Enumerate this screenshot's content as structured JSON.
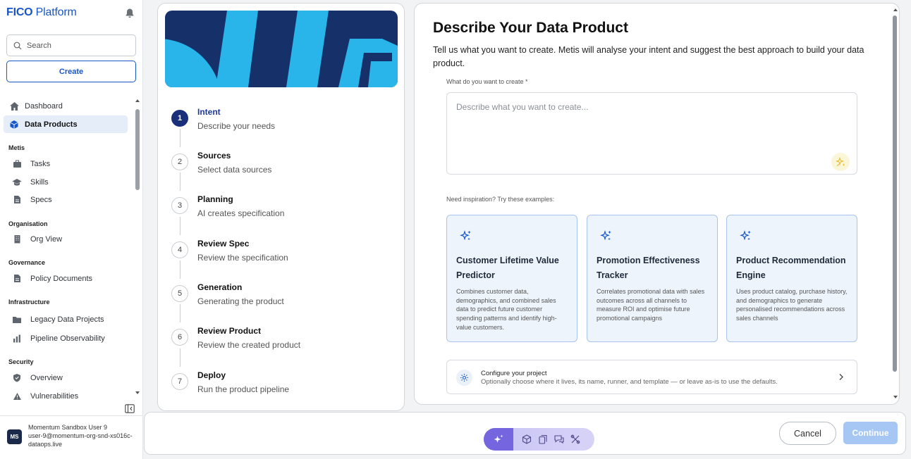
{
  "app": {
    "brand_bold": "FICO",
    "brand_rest": " Platform"
  },
  "sidebar": {
    "search_placeholder": "Search",
    "create_label": "Create",
    "items": [
      {
        "label": "Dashboard",
        "icon": "home-icon"
      },
      {
        "label": "Data Products",
        "icon": "cube-icon",
        "active": true
      }
    ],
    "sections": [
      {
        "label": "Metis",
        "items": [
          {
            "label": "Tasks",
            "icon": "briefcase-icon"
          },
          {
            "label": "Skills",
            "icon": "graduation-cap-icon"
          },
          {
            "label": "Specs",
            "icon": "document-icon"
          }
        ]
      },
      {
        "label": "Organisation",
        "items": [
          {
            "label": "Org View",
            "icon": "building-icon"
          }
        ]
      },
      {
        "label": "Governance",
        "items": [
          {
            "label": "Policy Documents",
            "icon": "document-icon"
          }
        ]
      },
      {
        "label": "Infrastructure",
        "items": [
          {
            "label": "Legacy Data Projects",
            "icon": "folder-icon"
          },
          {
            "label": "Pipeline Observability",
            "icon": "bar-chart-icon"
          }
        ]
      },
      {
        "label": "Security",
        "items": [
          {
            "label": "Overview",
            "icon": "shield-icon"
          },
          {
            "label": "Vulnerabilities",
            "icon": "warning-icon"
          }
        ]
      }
    ],
    "user": {
      "initials": "MS",
      "name": "Momentum Sandbox User 9",
      "email": "user-9@momentum-org-snd-xs016c-dataops.live"
    }
  },
  "stepper": {
    "steps": [
      {
        "num": "1",
        "title": "Intent",
        "desc": "Describe your needs",
        "active": true
      },
      {
        "num": "2",
        "title": "Sources",
        "desc": "Select data sources"
      },
      {
        "num": "3",
        "title": "Planning",
        "desc": "AI creates specification"
      },
      {
        "num": "4",
        "title": "Review Spec",
        "desc": "Review the specification"
      },
      {
        "num": "5",
        "title": "Generation",
        "desc": "Generating the product"
      },
      {
        "num": "6",
        "title": "Review Product",
        "desc": "Review the created product"
      },
      {
        "num": "7",
        "title": "Deploy",
        "desc": "Run the product pipeline"
      }
    ]
  },
  "main": {
    "title": "Describe Your Data Product",
    "intro": "Tell us what you want to create. Metis will analyse your intent and suggest the best approach to build your data product.",
    "field_label": "What do you want to create *",
    "field_placeholder": "Describe what you want to create...",
    "field_value": "",
    "inspiration_label": "Need inspiration? Try these examples:",
    "examples": [
      {
        "title": "Customer Lifetime Value Predictor",
        "desc": "Combines customer data, demographics, and combined sales data to predict future customer spending patterns and identify high-value customers."
      },
      {
        "title": "Promotion Effectiveness Tracker",
        "desc": "Correlates promotional data with sales outcomes across all channels to measure ROI and optimise future promotional campaigns"
      },
      {
        "title": "Product Recommendation Engine",
        "desc": "Uses product catalog, purchase history, and demographics to generate personalised recommendations across sales channels"
      }
    ],
    "configure": {
      "title": "Configure your project",
      "subtitle": "Optionally choose where it lives, its name, runner, and template — or leave as-is to use the defaults."
    }
  },
  "footer": {
    "cancel_label": "Cancel",
    "continue_label": "Continue",
    "toolbar_icons": [
      "sparkle-icon",
      "cube-icon",
      "copy-icon",
      "chat-icon",
      "tools-icon"
    ]
  },
  "colors": {
    "brand": "#1656c9",
    "active_step": "#1a2f7a",
    "hero_dark": "#16306a",
    "hero_light": "#29b5ea",
    "card_bg": "#eef4fc",
    "continue_disabled": "#a6c7f4",
    "toolbar_accent": "#7566e0"
  }
}
